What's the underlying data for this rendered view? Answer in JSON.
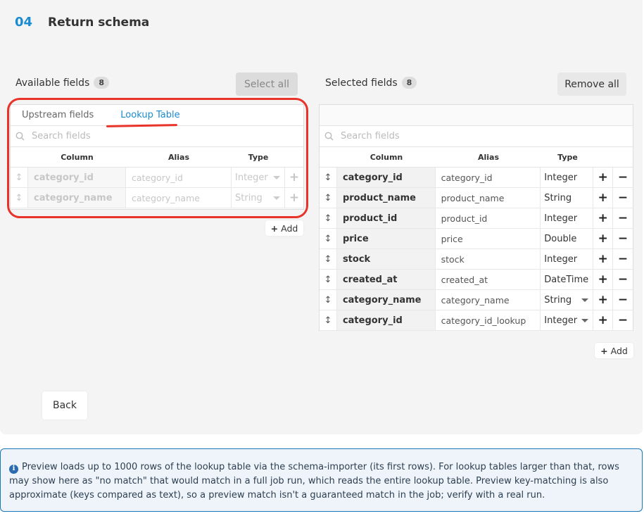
{
  "step": {
    "number": "04",
    "title": "Return schema"
  },
  "available": {
    "label": "Available fields",
    "count": "8",
    "select_all_label": "Select all",
    "tabs": [
      "Upstream fields",
      "Lookup Table"
    ],
    "search_placeholder": "Search fields",
    "headers": {
      "column": "Column",
      "alias": "Alias",
      "type": "Type"
    },
    "rows": [
      {
        "column": "category_id",
        "alias": "category_id",
        "type": "Integer"
      },
      {
        "column": "category_name",
        "alias": "category_name",
        "type": "String"
      }
    ],
    "add_label": "Add"
  },
  "selected": {
    "label": "Selected fields",
    "count": "8",
    "remove_all_label": "Remove all",
    "search_placeholder": "Search fields",
    "headers": {
      "column": "Column",
      "alias": "Alias",
      "type": "Type"
    },
    "rows": [
      {
        "column": "category_id",
        "alias": "category_id",
        "type": "Integer"
      },
      {
        "column": "product_name",
        "alias": "product_name",
        "type": "String"
      },
      {
        "column": "product_id",
        "alias": "product_id",
        "type": "Integer"
      },
      {
        "column": "price",
        "alias": "price",
        "type": "Double"
      },
      {
        "column": "stock",
        "alias": "stock",
        "type": "Integer"
      },
      {
        "column": "created_at",
        "alias": "created_at",
        "type": "DateTime"
      },
      {
        "column": "category_name",
        "alias": "category_name",
        "type": "String"
      },
      {
        "column": "category_id",
        "alias": "category_id_lookup",
        "type": "Integer"
      }
    ],
    "add_label": "Add"
  },
  "back_label": "Back",
  "info_text": "Preview loads up to 1000 rows of the lookup table via the schema-importer (its first rows). For lookup tables larger than that, rows may show here as \"no match\" that would match in a full job run, which reads the entire lookup table. Preview key-matching is also approximate (keys compared as text), so a preview match isn't a guaranteed match in the job; verify with a real run.",
  "colors": {
    "accent": "#1a8bd0",
    "annotation": "#e8332a",
    "info_border": "#1a78b8"
  }
}
